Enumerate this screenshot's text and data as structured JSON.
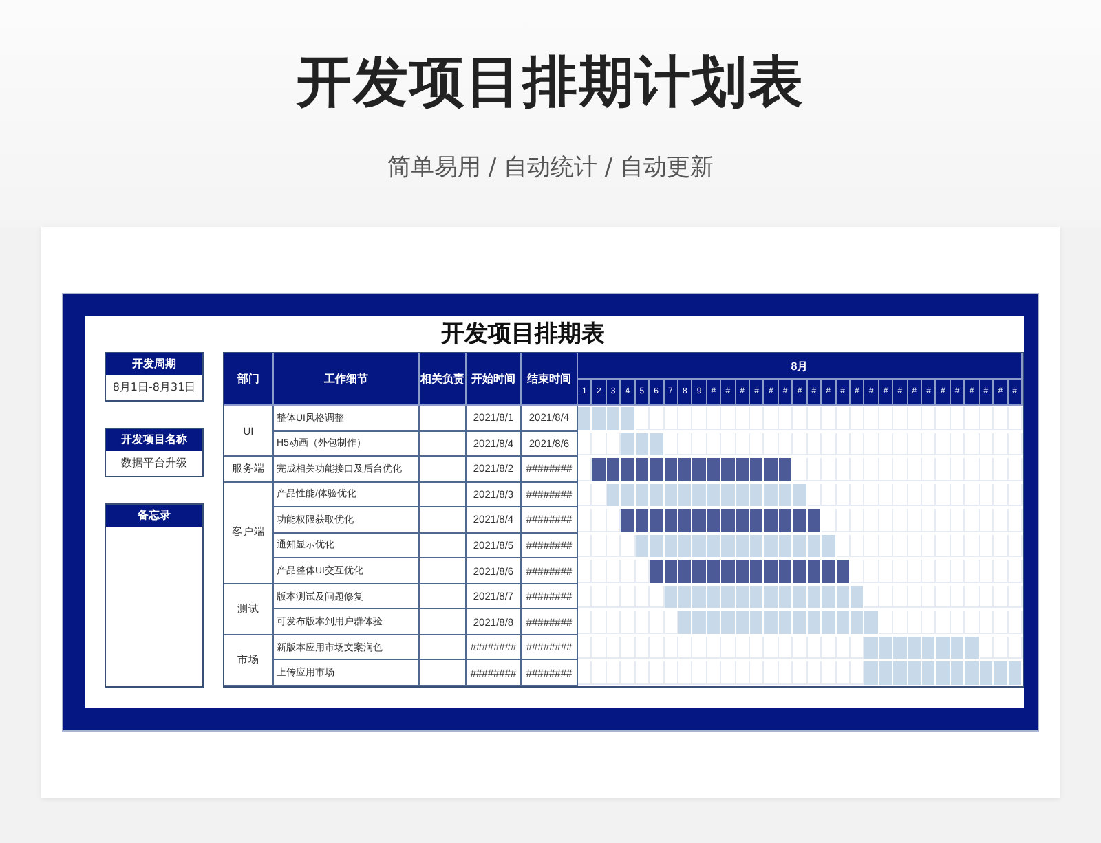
{
  "page": {
    "title": "开发项目排期计划表",
    "subtitle": "简单易用 / 自动统计 / 自动更新"
  },
  "sheet": {
    "title": "开发项目排期表",
    "info_boxes": [
      {
        "label": "开发周期",
        "value": "8月1日-8月31日"
      },
      {
        "label": "开发项目名称",
        "value": "数据平台升级"
      },
      {
        "label": "备忘录"
      }
    ],
    "columns": [
      "部门",
      "工作细节",
      "相关负责",
      "开始时间",
      "结束时间"
    ],
    "month": "8月",
    "days": [
      "1",
      "2",
      "3",
      "4",
      "5",
      "6",
      "7",
      "8",
      "9",
      "#",
      "#",
      "#",
      "#",
      "#",
      "#",
      "#",
      "#",
      "#",
      "#",
      "#",
      "#",
      "#",
      "#",
      "#",
      "#",
      "#",
      "#",
      "#",
      "#",
      "#",
      "#"
    ],
    "departments": [
      {
        "name": "UI",
        "tasks": [
          {
            "detail": "整体UI风格调整",
            "start": "2021/8/1",
            "end": "2021/8/4",
            "color": "#c8d9ea",
            "schedule": [
              true,
              true,
              true,
              true,
              false,
              false,
              false,
              false,
              false,
              false,
              false,
              false,
              false,
              false,
              false,
              false,
              false,
              false,
              false,
              false,
              false,
              false,
              false,
              false,
              false,
              false,
              false,
              false,
              false,
              false,
              false
            ]
          },
          {
            "detail": "H5动画（外包制作）",
            "start": "2021/8/4",
            "end": "2021/8/6",
            "color": "#c8d9ea",
            "schedule": [
              false,
              false,
              false,
              true,
              true,
              true,
              false,
              false,
              false,
              false,
              false,
              false,
              false,
              false,
              false,
              false,
              false,
              false,
              false,
              false,
              false,
              false,
              false,
              false,
              false,
              false,
              false,
              false,
              false,
              false,
              false
            ]
          }
        ]
      },
      {
        "name": "服务端",
        "tasks": [
          {
            "detail": "完成相关功能接口及后台优化",
            "start": "2021/8/2",
            "end": "########",
            "color": "#4d5a98",
            "schedule": [
              false,
              true,
              true,
              true,
              true,
              true,
              true,
              true,
              true,
              true,
              true,
              true,
              true,
              true,
              true,
              false,
              false,
              false,
              false,
              false,
              false,
              false,
              false,
              false,
              false,
              false,
              false,
              false,
              false,
              false,
              false
            ]
          }
        ]
      },
      {
        "name": "客户端",
        "tasks": [
          {
            "detail": "产品性能/体验优化",
            "start": "2021/8/3",
            "end": "########",
            "color": "#c8d9ea",
            "schedule": [
              false,
              false,
              true,
              true,
              true,
              true,
              true,
              true,
              true,
              true,
              true,
              true,
              true,
              true,
              true,
              true,
              false,
              false,
              false,
              false,
              false,
              false,
              false,
              false,
              false,
              false,
              false,
              false,
              false,
              false,
              false
            ]
          },
          {
            "detail": "功能权限获取优化",
            "start": "2021/8/4",
            "end": "########",
            "color": "#4d5a98",
            "schedule": [
              false,
              false,
              false,
              true,
              true,
              true,
              true,
              true,
              true,
              true,
              true,
              true,
              true,
              true,
              true,
              true,
              true,
              false,
              false,
              false,
              false,
              false,
              false,
              false,
              false,
              false,
              false,
              false,
              false,
              false,
              false
            ]
          },
          {
            "detail": "通知显示优化",
            "start": "2021/8/5",
            "end": "########",
            "color": "#c8d9ea",
            "schedule": [
              false,
              false,
              false,
              false,
              true,
              true,
              true,
              true,
              true,
              true,
              true,
              true,
              true,
              true,
              true,
              true,
              true,
              true,
              false,
              false,
              false,
              false,
              false,
              false,
              false,
              false,
              false,
              false,
              false,
              false,
              false
            ]
          },
          {
            "detail": "产品整体UI交互优化",
            "start": "2021/8/6",
            "end": "########",
            "color": "#4d5a98",
            "schedule": [
              false,
              false,
              false,
              false,
              false,
              true,
              true,
              true,
              true,
              true,
              true,
              true,
              true,
              true,
              true,
              true,
              true,
              true,
              true,
              false,
              false,
              false,
              false,
              false,
              false,
              false,
              false,
              false,
              false,
              false,
              false
            ]
          }
        ]
      },
      {
        "name": "测试",
        "tasks": [
          {
            "detail": "版本测试及问题修复",
            "start": "2021/8/7",
            "end": "########",
            "color": "#c8d9ea",
            "schedule": [
              false,
              false,
              false,
              false,
              false,
              false,
              true,
              true,
              true,
              true,
              true,
              true,
              true,
              true,
              true,
              true,
              true,
              true,
              true,
              true,
              false,
              false,
              false,
              false,
              false,
              false,
              false,
              false,
              false,
              false,
              false
            ]
          },
          {
            "detail": "可发布版本到用户群体验",
            "start": "2021/8/8",
            "end": "########",
            "color": "#c8d9ea",
            "schedule": [
              false,
              false,
              false,
              false,
              false,
              false,
              false,
              true,
              true,
              true,
              true,
              true,
              true,
              true,
              true,
              true,
              true,
              true,
              true,
              true,
              true,
              false,
              false,
              false,
              false,
              false,
              false,
              false,
              false,
              false,
              false
            ]
          }
        ]
      },
      {
        "name": "市场",
        "tasks": [
          {
            "detail": "新版本应用市场文案润色",
            "start": "########",
            "end": "########",
            "color": "#c8d9ea",
            "schedule": [
              false,
              false,
              false,
              false,
              false,
              false,
              false,
              false,
              false,
              false,
              false,
              false,
              false,
              false,
              false,
              false,
              false,
              false,
              false,
              false,
              true,
              true,
              true,
              true,
              true,
              true,
              true,
              true,
              false,
              false,
              false
            ]
          },
          {
            "detail": "上传应用市场",
            "start": "########",
            "end": "########",
            "color": "#c8d9ea",
            "schedule": [
              false,
              false,
              false,
              false,
              false,
              false,
              false,
              false,
              false,
              false,
              false,
              false,
              false,
              false,
              false,
              false,
              false,
              false,
              false,
              false,
              true,
              true,
              true,
              true,
              true,
              true,
              true,
              true,
              true,
              true,
              true
            ]
          }
        ]
      }
    ]
  }
}
